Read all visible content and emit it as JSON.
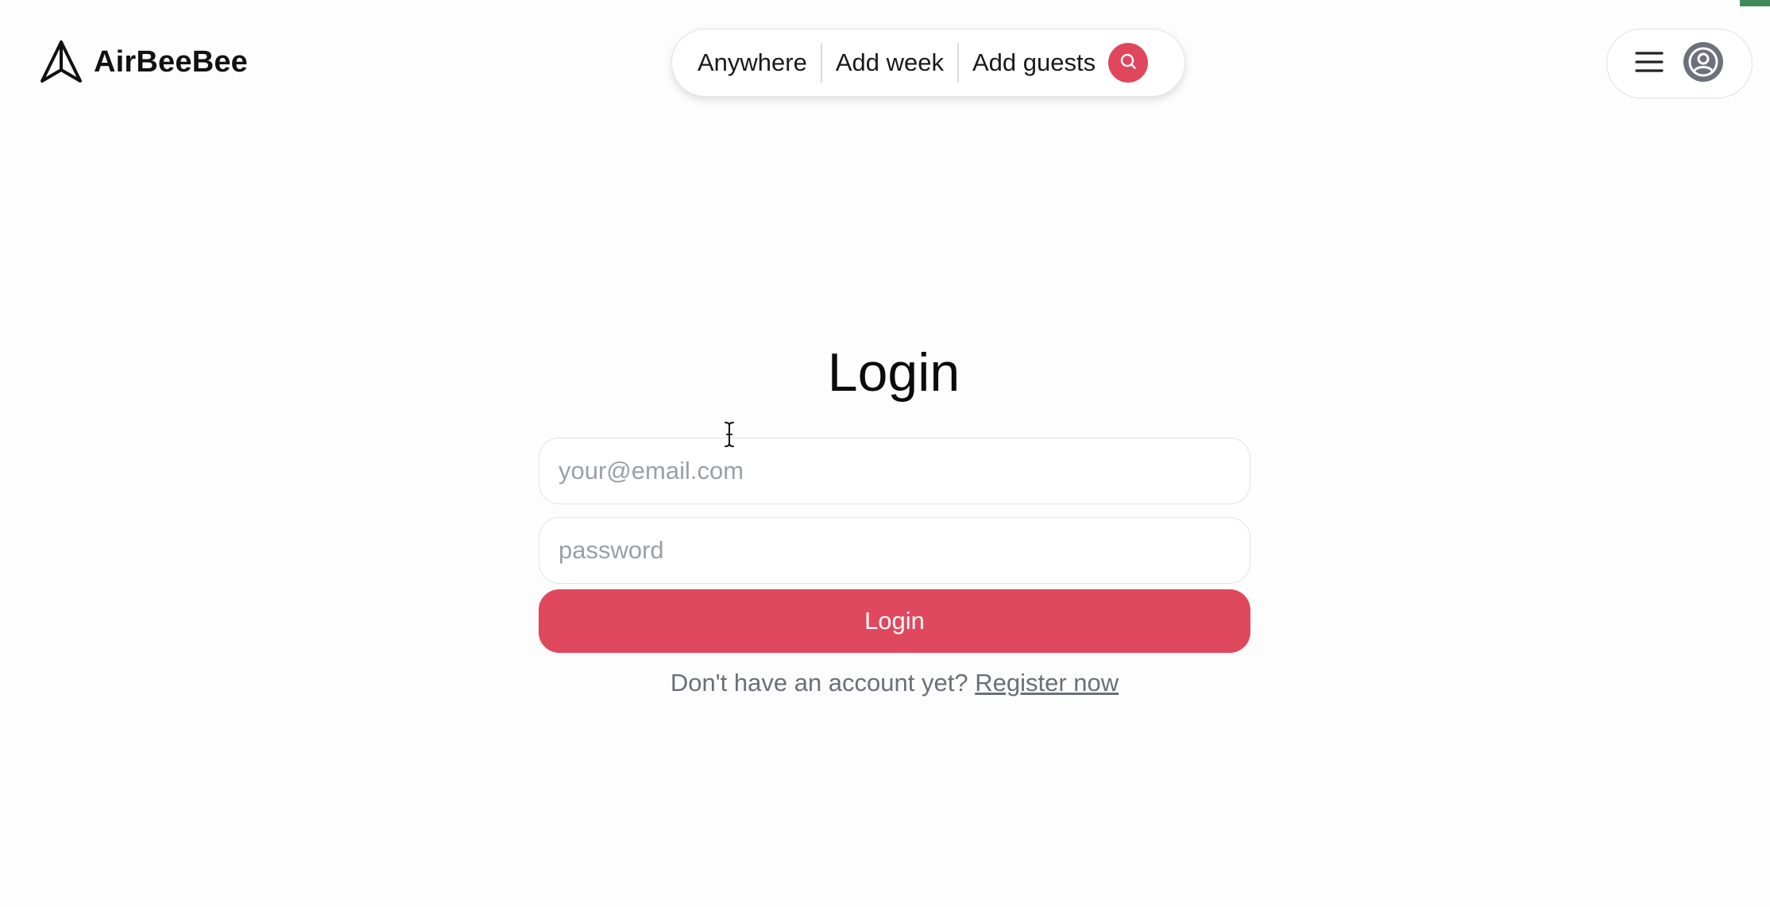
{
  "brand": {
    "name": "AirBeeBee",
    "logo_icon": "paper-plane-icon"
  },
  "search": {
    "where_label": "Anywhere",
    "week_label": "Add week",
    "guests_label": "Add guests",
    "button_icon": "search-icon",
    "button_color": "#e0475d"
  },
  "user_menu": {
    "menu_icon": "hamburger-menu-icon",
    "avatar_icon": "user-avatar-icon"
  },
  "login": {
    "title": "Login",
    "email_placeholder": "your@email.com",
    "email_value": "",
    "password_placeholder": "password",
    "password_value": "",
    "submit_label": "Login",
    "submit_color": "#e0485e",
    "register_prompt": "Don't have an account yet?",
    "register_link": "Register now"
  }
}
